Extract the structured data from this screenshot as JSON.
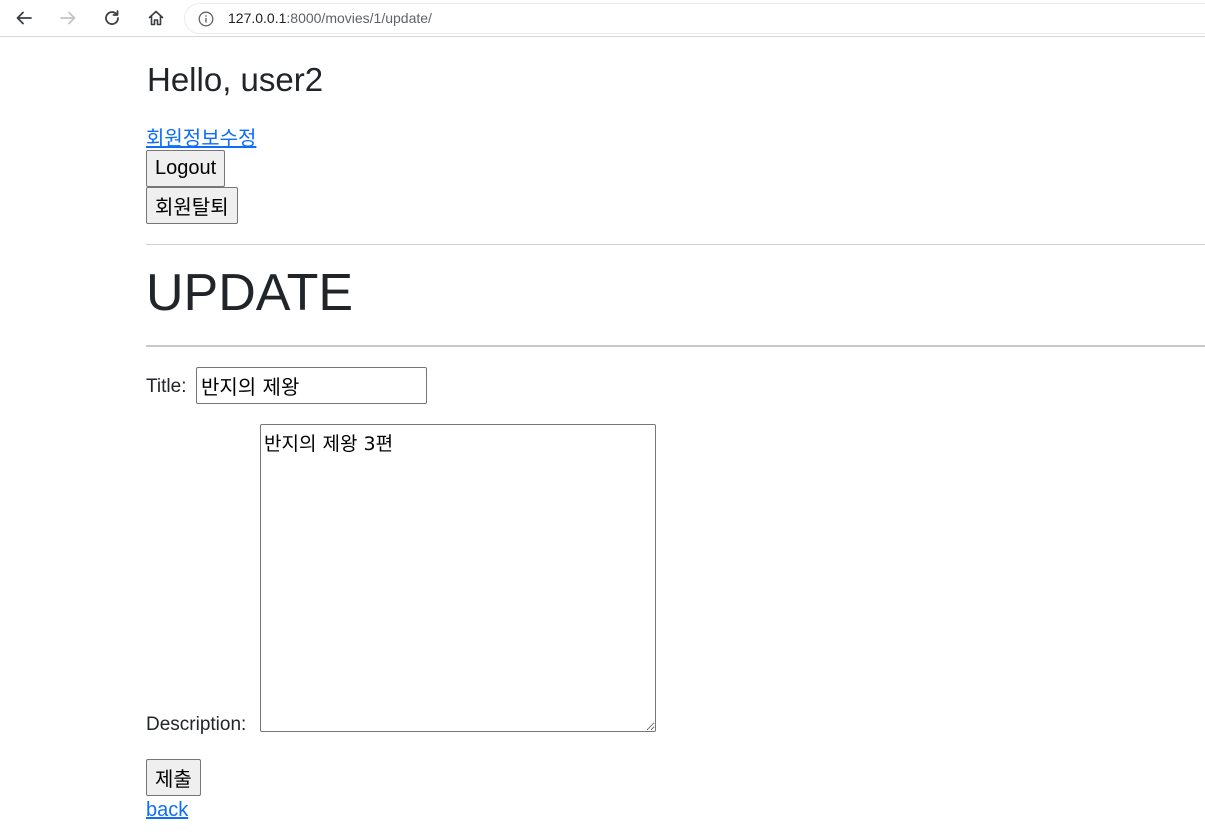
{
  "browser": {
    "url_host": "127.0.0.1",
    "url_path": ":8000/movies/1/update/",
    "icons": [
      "back-arrow-icon",
      "forward-arrow-icon",
      "reload-icon",
      "home-icon",
      "info-icon"
    ]
  },
  "header": {
    "greeting": "Hello, user2",
    "profile_link": "회원정보수정",
    "logout_button": "Logout",
    "delete_account_button": "회원탈퇴"
  },
  "page": {
    "title": "UPDATE"
  },
  "form": {
    "title_label": "Title:",
    "title_value": "반지의 제왕",
    "description_label": "Description:",
    "description_value": "반지의 제왕 3편",
    "submit_button": "제출"
  },
  "footer": {
    "back_link": "back"
  },
  "colors": {
    "link": "#0d6efd",
    "text": "#212529",
    "button_bg": "#efefef"
  }
}
